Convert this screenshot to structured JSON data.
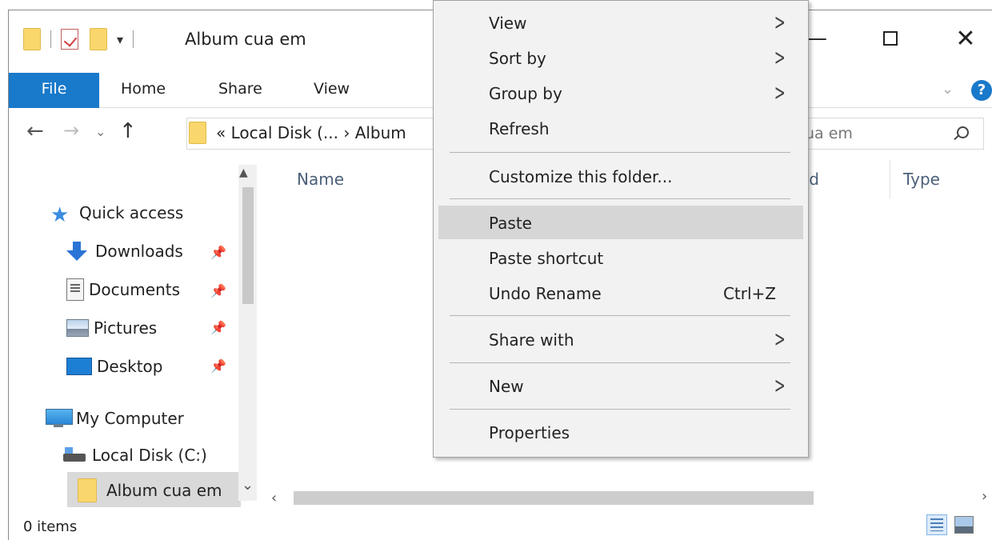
{
  "window": {
    "title": "Album cua em",
    "minimize_glyph": "—",
    "close_glyph": "✕"
  },
  "ribbon": {
    "tabs": [
      "File",
      "Home",
      "Share",
      "View"
    ],
    "collapse_glyph": "⌄",
    "help_glyph": "?"
  },
  "address": {
    "path_text": "« Local Disk (... › Album",
    "search_text": "ua em"
  },
  "nav": {
    "items": [
      {
        "label": "Quick access",
        "icon": "star-icon"
      },
      {
        "label": "Downloads",
        "icon": "downloads-icon",
        "pinned": true
      },
      {
        "label": "Documents",
        "icon": "documents-icon",
        "pinned": true
      },
      {
        "label": "Pictures",
        "icon": "pictures-icon",
        "pinned": true
      },
      {
        "label": "Desktop",
        "icon": "desktop-icon",
        "pinned": true
      },
      {
        "label": "My Computer",
        "icon": "computer-icon"
      },
      {
        "label": "Local Disk (C:)",
        "icon": "disk-icon"
      },
      {
        "label": "Album cua em",
        "icon": "folder-icon",
        "selected": true
      }
    ]
  },
  "columns": {
    "name": "Name",
    "modified_partial": "ed",
    "type": "Type"
  },
  "status": {
    "items": "0 items"
  },
  "context_menu": {
    "items": [
      {
        "label": "View",
        "submenu": true
      },
      {
        "label": "Sort by",
        "submenu": true
      },
      {
        "label": "Group by",
        "submenu": true
      },
      {
        "label": "Refresh"
      },
      {
        "label": "Customize this folder..."
      },
      {
        "label": "Paste",
        "highlighted": true
      },
      {
        "label": "Paste shortcut"
      },
      {
        "label": "Undo Rename",
        "shortcut": "Ctrl+Z"
      },
      {
        "label": "Share with",
        "submenu": true
      },
      {
        "label": "New",
        "submenu": true
      },
      {
        "label": "Properties"
      }
    ]
  },
  "colors": {
    "accent": "#1979ca",
    "menu_bg": "#f2f2f2",
    "menu_highlight": "#d6d6d6",
    "selection": "#d9d9d9"
  }
}
